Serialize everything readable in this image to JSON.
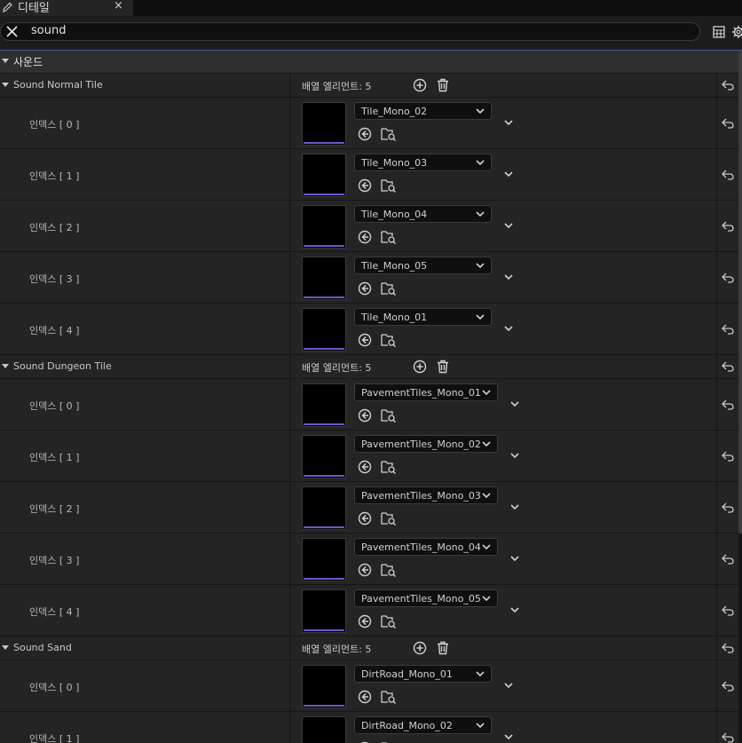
{
  "tab": {
    "title": "디테일",
    "close": "×"
  },
  "search": {
    "value": "sound"
  },
  "section": {
    "label": "사운드"
  },
  "colors": {
    "accent": "#2a5a98",
    "thumb_bar": "#6a58c8"
  },
  "icons": [
    "pencil-icon",
    "close-icon",
    "clear-search-icon",
    "table-view-icon",
    "settings-gear-icon",
    "add-element-icon",
    "delete-all-icon",
    "use-selected-asset-icon",
    "browse-asset-icon",
    "chevron-down-icon",
    "reset-to-default-icon"
  ],
  "groups": [
    {
      "name": "Sound Normal Tile",
      "count": "배열 엘리먼트: 5",
      "items": [
        {
          "index": "인덱스 [ 0 ]",
          "asset": "Tile_Mono_02"
        },
        {
          "index": "인덱스 [ 1 ]",
          "asset": "Tile_Mono_03"
        },
        {
          "index": "인덱스 [ 2 ]",
          "asset": "Tile_Mono_04"
        },
        {
          "index": "인덱스 [ 3 ]",
          "asset": "Tile_Mono_05"
        },
        {
          "index": "인덱스 [ 4 ]",
          "asset": "Tile_Mono_01"
        }
      ]
    },
    {
      "name": "Sound Dungeon Tile",
      "count": "배열 엘리먼트: 5",
      "items": [
        {
          "index": "인덱스 [ 0 ]",
          "asset": "PavementTiles_Mono_01"
        },
        {
          "index": "인덱스 [ 1 ]",
          "asset": "PavementTiles_Mono_02"
        },
        {
          "index": "인덱스 [ 2 ]",
          "asset": "PavementTiles_Mono_03"
        },
        {
          "index": "인덱스 [ 3 ]",
          "asset": "PavementTiles_Mono_04"
        },
        {
          "index": "인덱스 [ 4 ]",
          "asset": "PavementTiles_Mono_05"
        }
      ]
    },
    {
      "name": "Sound Sand",
      "count": "배열 엘리먼트: 5",
      "items": [
        {
          "index": "인덱스 [ 0 ]",
          "asset": "DirtRoad_Mono_01"
        },
        {
          "index": "인덱스 [ 1 ]",
          "asset": "DirtRoad_Mono_02"
        }
      ]
    }
  ]
}
